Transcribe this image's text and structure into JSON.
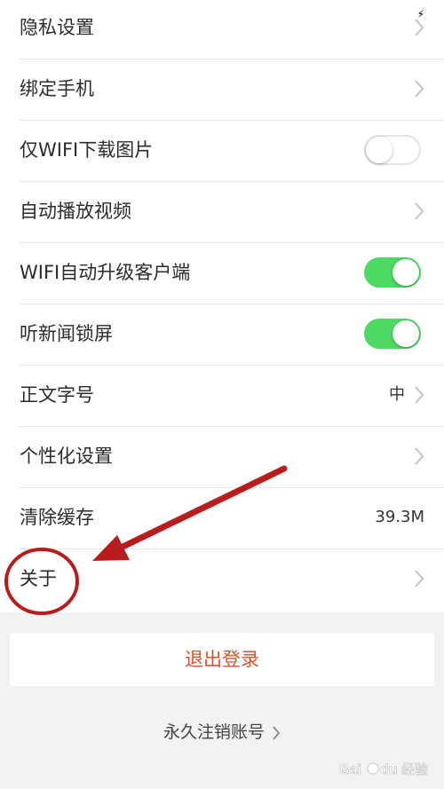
{
  "settings": {
    "rows": [
      {
        "label": "隐私设置",
        "accessory": "chevron"
      },
      {
        "label": "绑定手机",
        "accessory": "chevron"
      },
      {
        "label": "仅WIFI下载图片",
        "accessory": "toggle",
        "toggle_on": false
      },
      {
        "label": "自动播放视频",
        "accessory": "chevron"
      },
      {
        "label": "WIFI自动升级客户端",
        "accessory": "toggle",
        "toggle_on": true
      },
      {
        "label": "听新闻锁屏",
        "accessory": "toggle",
        "toggle_on": true
      },
      {
        "label": "正文字号",
        "accessory": "value-chevron",
        "value": "中"
      },
      {
        "label": "个性化设置",
        "accessory": "chevron"
      },
      {
        "label": "清除缓存",
        "accessory": "value",
        "value": "39.3M"
      },
      {
        "label": "关于",
        "accessory": "chevron"
      }
    ]
  },
  "logout": {
    "label": "退出登录"
  },
  "deactivate": {
    "label": "永久注销账号"
  },
  "watermark": {
    "text": "Bai du 经验"
  },
  "icons": {
    "chevron": "chevron-right-icon",
    "status": "lightning-icon"
  },
  "colors": {
    "toggle_on": "#4cd964",
    "logout_text": "#d9532c",
    "annotation_red": "#b81c1c",
    "background": "#f2f2f2"
  }
}
